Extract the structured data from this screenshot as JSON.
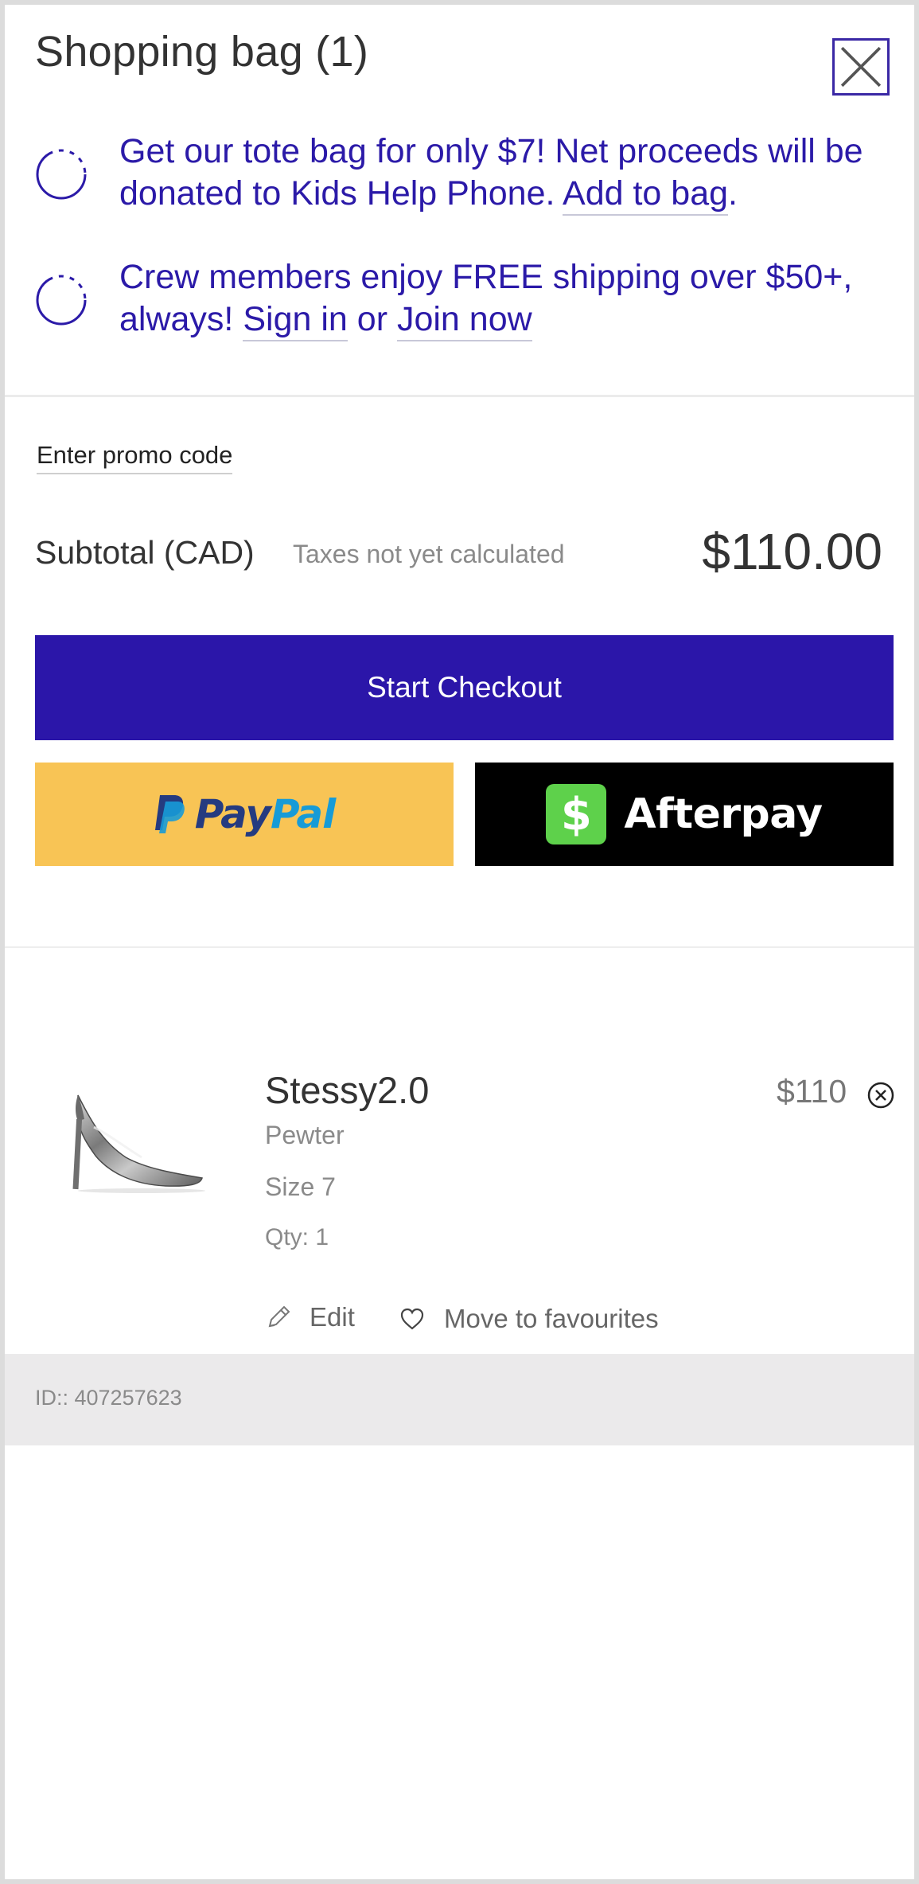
{
  "header": {
    "title": "Shopping bag (1)"
  },
  "promos": [
    {
      "text_before": "Get our tote bag for only $7! Net proceeds will be donated to Kids Help Phone. ",
      "link": "Add to bag",
      "text_after": "."
    },
    {
      "text_before": "Crew members enjoy FREE shipping over $50+, always! ",
      "link1": "Sign in",
      "text_mid": " or ",
      "link2": "Join now"
    }
  ],
  "promo_code_label": "Enter promo code",
  "summary": {
    "subtotal_label": "Subtotal (CAD)",
    "tax_note": "Taxes not yet calculated",
    "subtotal_value": "$110.00"
  },
  "buttons": {
    "checkout": "Start Checkout",
    "paypal_pay": "Pay",
    "paypal_pal": "Pal",
    "afterpay": "Afterpay",
    "afterpay_symbol": "$"
  },
  "item": {
    "name": "Stessy2.0",
    "color": "Pewter",
    "size": "Size 7",
    "qty": "Qty: 1",
    "price": "$110",
    "edit_label": "Edit",
    "favourite_label": "Move to favourites"
  },
  "order_id": "ID:: 407257623",
  "colors": {
    "accent": "#2b16a9",
    "paypal_bg": "#f8c455",
    "afterpay_bg": "#000000",
    "afterpay_badge": "#5ed14b"
  },
  "icons": {
    "close": "close-icon",
    "promo": "dashed-circle-icon",
    "remove": "remove-circle-icon",
    "edit": "pencil-icon",
    "favourite": "heart-icon"
  }
}
